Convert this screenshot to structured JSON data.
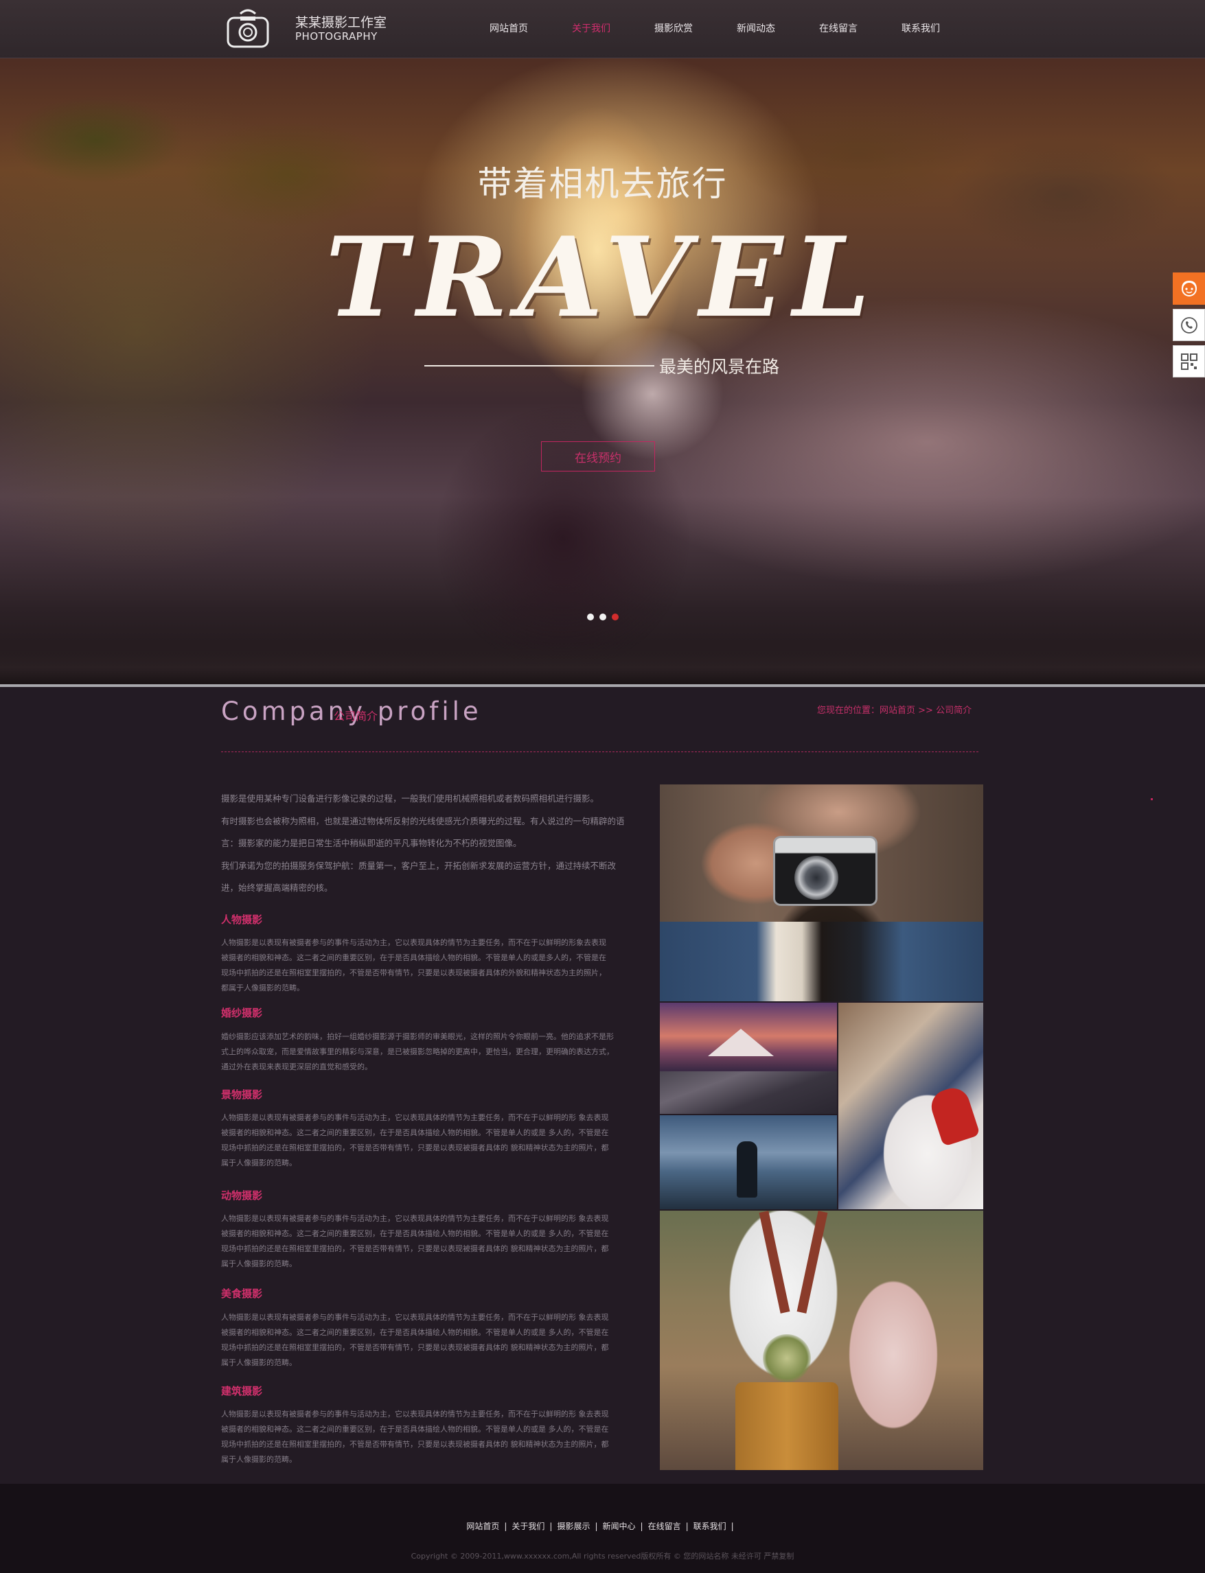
{
  "header": {
    "logo_cn": "某某摄影工作室",
    "logo_en": "PHOTOGRAPHY",
    "nav": [
      "网站首页",
      "关于我们",
      "摄影欣赏",
      "新闻动态",
      "在线留言",
      "联系我们"
    ],
    "active_index": 1
  },
  "hero": {
    "title_cn": "带着相机去旅行",
    "title_en": "TRAVEL",
    "subtitle": "最美的风景在路",
    "button": "在线预约",
    "slides": 3,
    "active_slide": 3
  },
  "side_tools": [
    "customer-service-icon",
    "phone-icon",
    "qrcode-icon"
  ],
  "profile": {
    "title_en": "Company profile",
    "title_cn": "公司简介",
    "breadcrumb": {
      "prefix": "您现在的位置：",
      "home": "网站首页",
      "sep": " >> ",
      "current": "公司简介"
    },
    "intro": [
      "摄影是使用某种专门设备进行影像记录的过程，一般我们使用机械照相机或者数码照相机进行摄影。",
      "有时摄影也会被称为照相，也就是通过物体所反射的光线使感光介质曝光的过程。有人说过的一句精辟的语",
      "言：摄影家的能力是把日常生活中稍纵即逝的平凡事物转化为不朽的视觉图像。",
      "我们承诺为您的拍摄服务保驾护航：质量第一，客户至上，开拓创新求发展的运营方针，通过持续不断改",
      "进，始终掌握高端精密的核。"
    ],
    "categories": [
      {
        "title": "人物摄影",
        "lines": [
          "人物摄影是以表现有被摄者参与的事件与活动为主，它以表现具体的情节为主要任务，而不在于以鲜明的形象去表现",
          "被摄者的相貌和神态。这二者之间的重要区别，在于是否具体描绘人物的相貌。不管是单人的或是多人的，不管是在",
          "现场中抓拍的还是在照相室里摆拍的，不管是否带有情节，只要是以表现被摄者具体的外貌和精神状态为主的照片，",
          "都属于人像摄影的范畴。"
        ]
      },
      {
        "title": "婚纱摄影",
        "lines": [
          "婚纱摄影应该添加艺术的韵味，拍好一组婚纱摄影源于摄影师的审美眼光，这样的照片令你眼前一亮。他的追求不是形",
          "式上的哗众取宠，而是爱情故事里的精彩与深意，是已被摄影忽略掉的更高中，更恰当，更合理，更明确的表达方式，",
          "通过外在表现来表现更深层的直觉和感受的。"
        ]
      },
      {
        "title": "景物摄影",
        "lines": [
          "人物摄影是以表现有被摄者参与的事件与活动为主，它以表现具体的情节为主要任务，而不在于以鲜明的形 象去表现",
          "被摄者的相貌和神态。这二者之间的重要区别，在于是否具体描绘人物的相貌。不管是单人的或是 多人的，不管是在",
          "现场中抓拍的还是在照相室里摆拍的，不管是否带有情节，只要是以表现被摄者具体的 貌和精神状态为主的照片，都",
          "属于人像摄影的范畴。"
        ]
      },
      {
        "title": "动物摄影",
        "lines": [
          "人物摄影是以表现有被摄者参与的事件与活动为主，它以表现具体的情节为主要任务，而不在于以鲜明的形 象去表现",
          "被摄者的相貌和神态。这二者之间的重要区别，在于是否具体描绘人物的相貌。不管是单人的或是 多人的，不管是在",
          "现场中抓拍的还是在照相室里摆拍的，不管是否带有情节，只要是以表现被摄者具体的 貌和精神状态为主的照片，都",
          "属于人像摄影的范畴。"
        ]
      },
      {
        "title": "美食摄影",
        "lines": [
          "人物摄影是以表现有被摄者参与的事件与活动为主，它以表现具体的情节为主要任务，而不在于以鲜明的形 象去表现",
          "被摄者的相貌和神态。这二者之间的重要区别，在于是否具体描绘人物的相貌。不管是单人的或是 多人的，不管是在",
          "现场中抓拍的还是在照相室里摆拍的，不管是否带有情节，只要是以表现被摄者具体的 貌和精神状态为主的照片，都",
          "属于人像摄影的范畴。"
        ]
      },
      {
        "title": "建筑摄影",
        "lines": [
          "人物摄影是以表现有被摄者参与的事件与活动为主，它以表现具体的情节为主要任务，而不在于以鲜明的形 象去表现",
          "被摄者的相貌和神态。这二者之间的重要区别，在于是否具体描绘人物的相貌。不管是单人的或是 多人的，不管是在",
          "现场中抓拍的还是在照相室里摆拍的，不管是否带有情节，只要是以表现被摄者具体的 貌和精神状态为主的照片，都",
          "属于人像摄影的范畴。"
        ]
      }
    ]
  },
  "footer": {
    "nav": [
      "网站首页",
      "关于我们",
      "摄影展示",
      "新闻中心",
      "在线留言",
      "联系我们"
    ],
    "separator": "|",
    "copyright": "Copyright © 2009-2011,www.xxxxxx.com,All rights reserved版权所有 © 您的网站名称 未经许可 严禁复制"
  },
  "colors": {
    "accent": "#d22d6e",
    "background": "#231b24",
    "header": "#332a2e",
    "footer": "#161016",
    "side_tool_active": "#f27123"
  }
}
